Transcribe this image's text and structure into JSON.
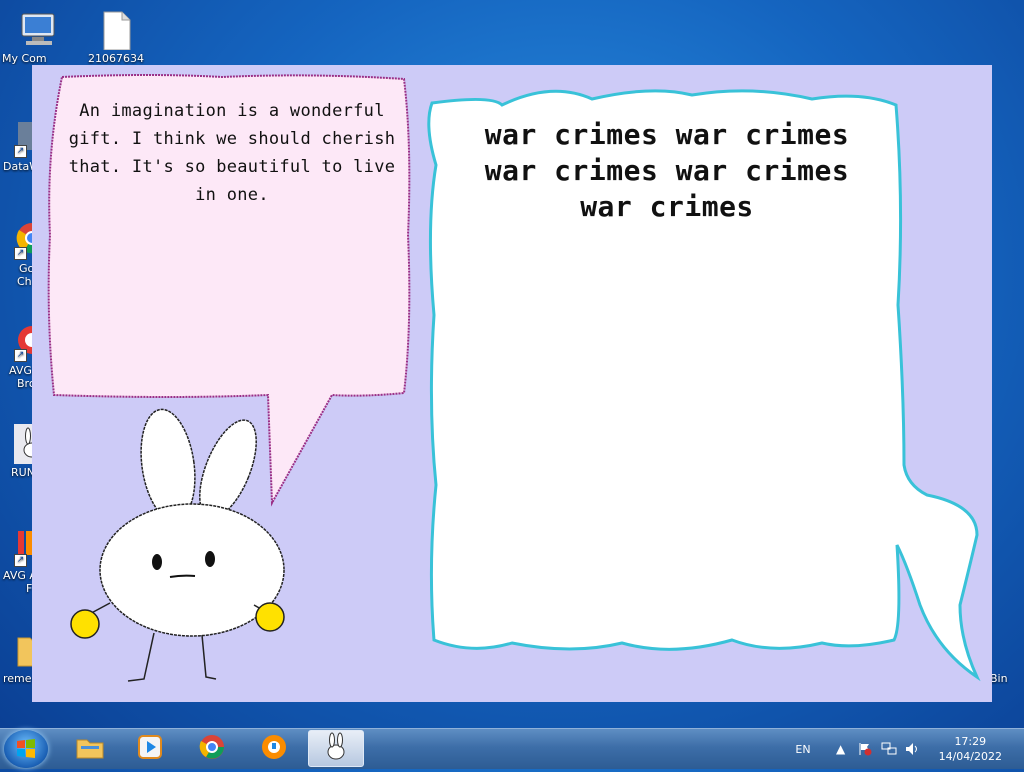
{
  "desktop": {
    "icons": [
      {
        "label": "My Com",
        "icon": "computer-icon"
      },
      {
        "label": "21067634",
        "icon": "document-icon"
      },
      {
        "label": "DataW",
        "icon": "shortcut-icon"
      },
      {
        "label": "Go",
        "label2": "Ch",
        "icon": "chrome-icon"
      },
      {
        "label": "AVG",
        "label2": "Bro",
        "icon": "avg-browser-icon"
      },
      {
        "label": "RUN",
        "icon": "bunny-icon"
      },
      {
        "label": "AVG A",
        "label2": "F",
        "icon": "avg-antivirus-icon"
      },
      {
        "label": "reme",
        "icon": "folder-icon"
      },
      {
        "label": "Bin",
        "icon": "recycle-bin-icon"
      }
    ]
  },
  "app": {
    "left_bubble_text": "An imagination is a wonderful gift. I think we should cherish that. It's so beautiful to live in one.",
    "right_bubble_text": "war crimes war crimes war crimes war crimes war crimes",
    "colors": {
      "background": "#cdcbf7",
      "left_bubble": "#fde8f7",
      "right_bubble": "#ffffff",
      "accent_cyan": "#39c2d8",
      "hand_yellow": "#ffe100"
    }
  },
  "taskbar": {
    "buttons": [
      {
        "icon": "windows-start-icon"
      },
      {
        "icon": "file-explorer-icon"
      },
      {
        "icon": "media-player-icon"
      },
      {
        "icon": "chrome-icon"
      },
      {
        "icon": "avg-browser-icon"
      },
      {
        "icon": "bunny-app-icon",
        "active": true
      }
    ],
    "tray": {
      "language": "EN",
      "time": "17:29",
      "date": "14/04/2022"
    }
  }
}
